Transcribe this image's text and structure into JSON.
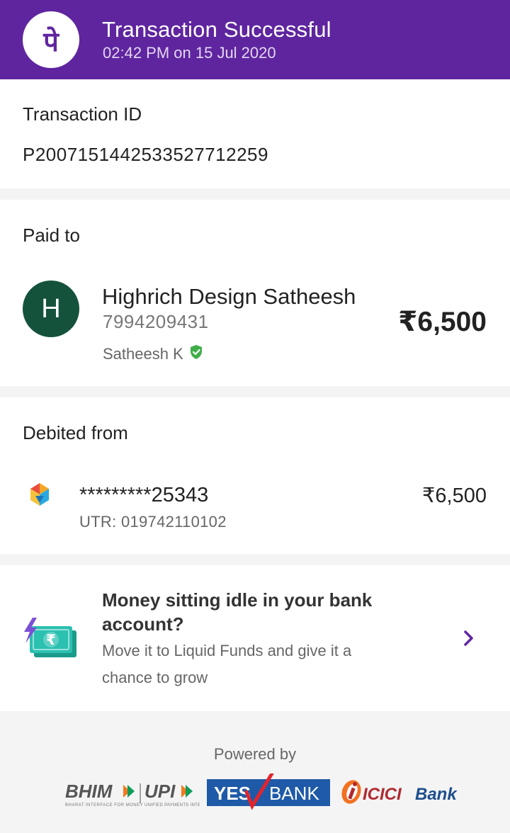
{
  "header": {
    "logo_glyph": "पे",
    "title": "Transaction Successful",
    "subtitle": "02:42 PM on 15 Jul 2020",
    "brand_color": "#5f259f"
  },
  "transaction": {
    "label": "Transaction ID",
    "id": "P2007151442533527712259"
  },
  "paid_to": {
    "label": "Paid to",
    "avatar_letter": "H",
    "name": "Highrich Design Satheesh",
    "phone": "7994209431",
    "verified_name": "Satheesh K",
    "verified_icon": "verified-shield-icon",
    "amount": "₹6,500"
  },
  "debited_from": {
    "label": "Debited from",
    "bank_icon": "bank-logo-icon",
    "account": "*********25343",
    "utr": "UTR: 019742110102",
    "amount": "₹6,500"
  },
  "promo": {
    "icon": "money-lightning-icon",
    "title": "Money sitting idle in your bank account?",
    "text": "Move it to Liquid Funds and give it a chance to grow",
    "chevron": "chevron-right-icon"
  },
  "footer": {
    "powered_by": "Powered by",
    "partners": [
      "BHIM UPI",
      "YES BANK",
      "ICICI Bank"
    ]
  }
}
